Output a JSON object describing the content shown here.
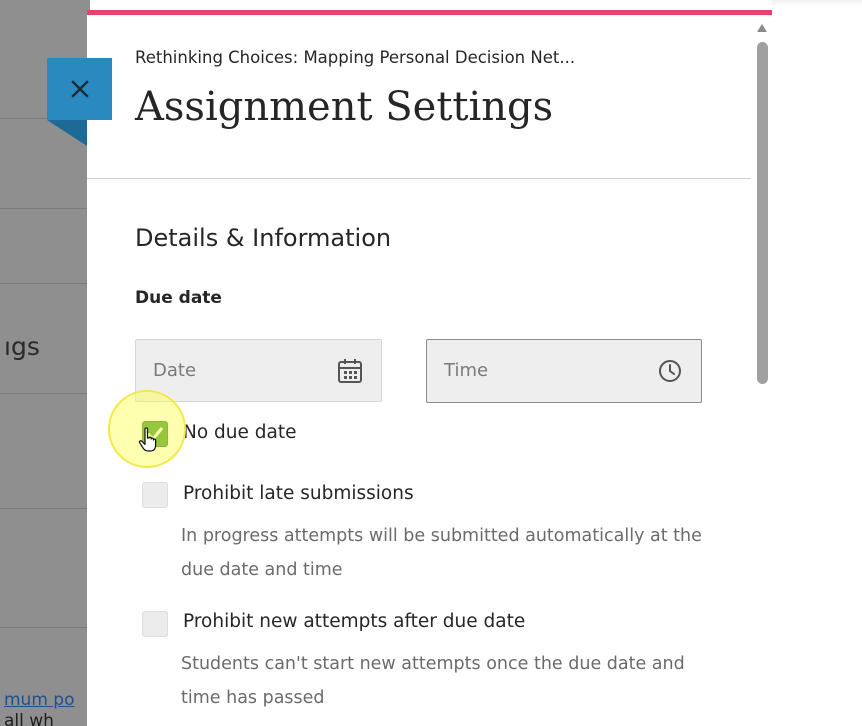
{
  "background": {
    "heading_fragment": "ıgs",
    "link_fragment": "mum po",
    "link_fragment_2": "all wh"
  },
  "panel": {
    "breadcrumb": "Rethinking Choices: Mapping Personal Decision Net...",
    "title": "Assignment Settings",
    "accent_color": "#e8416f",
    "close_button": {
      "icon": "close-icon",
      "color": "#2a89be"
    }
  },
  "details": {
    "heading": "Details & Information",
    "due_date_label": "Due date",
    "date_placeholder": "Date",
    "time_placeholder": "Time",
    "date_icon": "calendar-icon",
    "time_icon": "clock-icon"
  },
  "options": [
    {
      "label": "No due date",
      "checked": true,
      "help": ""
    },
    {
      "label": "Prohibit late submissions",
      "checked": false,
      "help": "In progress attempts will be submitted automatically at the due date and time"
    },
    {
      "label": "Prohibit new attempts after due date",
      "checked": false,
      "help": "Students can't start new attempts once the due date and time has passed"
    }
  ]
}
